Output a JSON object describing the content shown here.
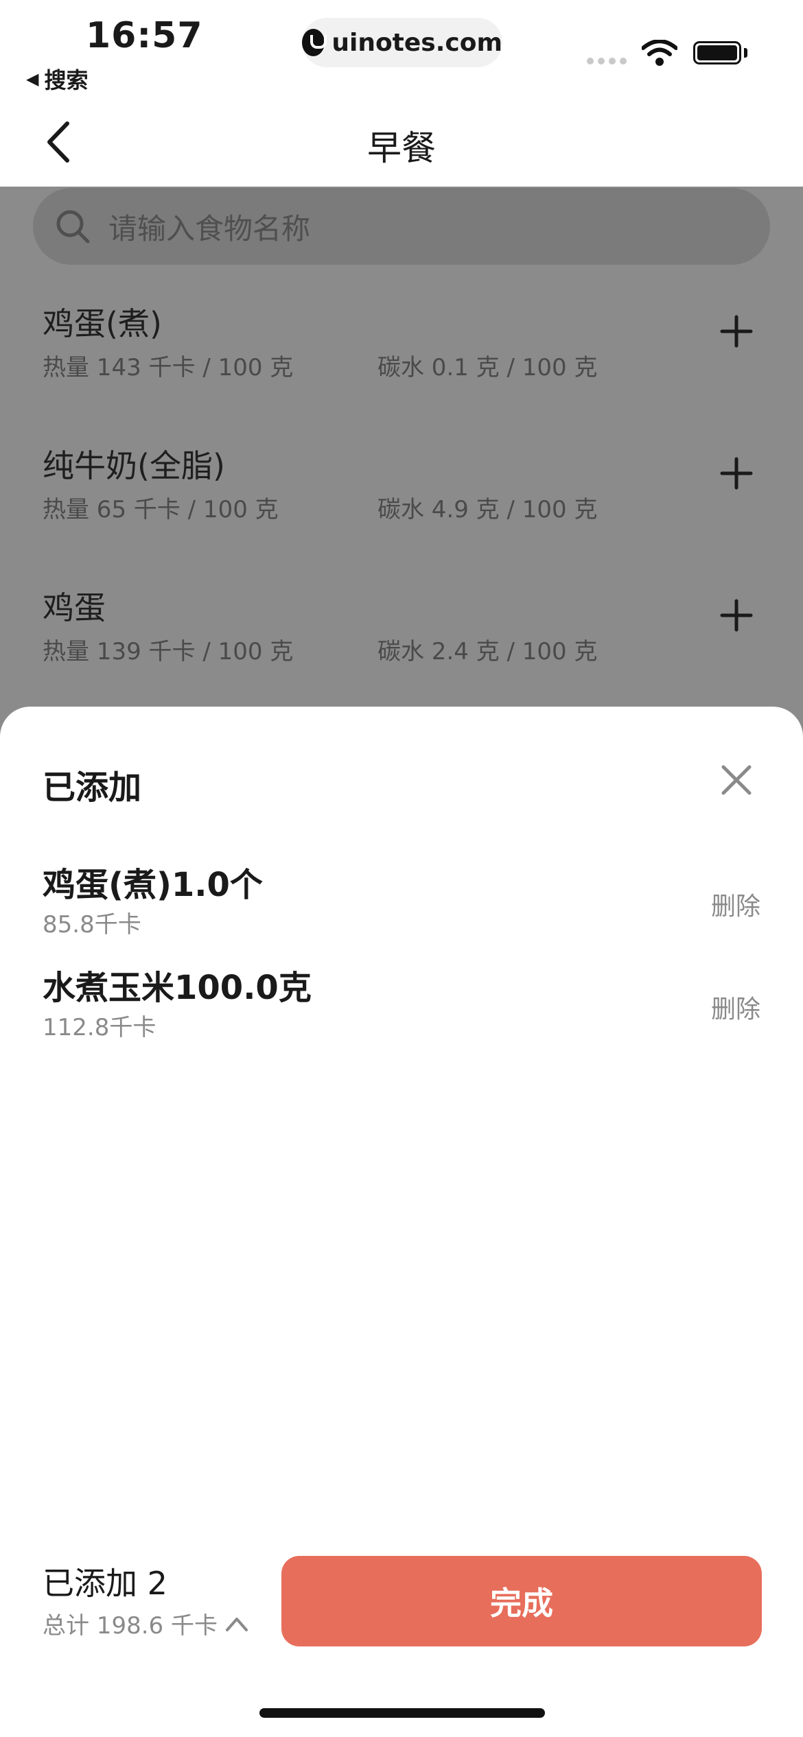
{
  "status_bar": {
    "time": "16:57",
    "back_label": "搜索",
    "back_arrow": "◀",
    "url": "uinotes.com"
  },
  "nav": {
    "title": "早餐"
  },
  "search": {
    "placeholder": "请输入食物名称"
  },
  "foods": [
    {
      "name": "鸡蛋(煮)",
      "calories": "热量 143 千卡 / 100 克",
      "carbs": "碳水 0.1 克 / 100 克"
    },
    {
      "name": "纯牛奶(全脂)",
      "calories": "热量 65 千卡 / 100 克",
      "carbs": "碳水 4.9 克 / 100 克"
    },
    {
      "name": "鸡蛋",
      "calories": "热量 139 千卡 / 100 克",
      "carbs": "碳水 2.4 克 / 100 克"
    }
  ],
  "sheet": {
    "title": "已添加",
    "items": [
      {
        "name": "鸡蛋(煮)1.0个",
        "kcal": "85.8千卡",
        "delete_label": "删除"
      },
      {
        "name": "水煮玉米100.0克",
        "kcal": "112.8千卡",
        "delete_label": "删除"
      }
    ]
  },
  "footer": {
    "added_count": "已添加 2",
    "total": "总计 198.6 千卡",
    "done_label": "完成"
  },
  "colors": {
    "accent": "#e76e5b",
    "overlay": "#8b8b8b"
  }
}
